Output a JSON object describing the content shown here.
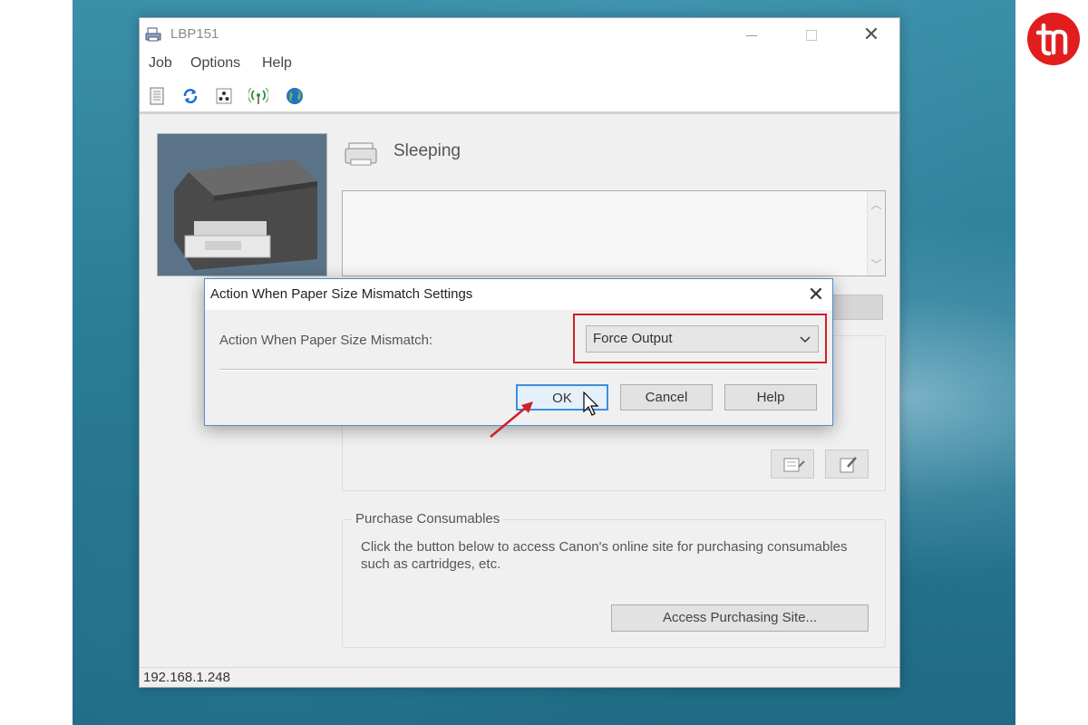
{
  "window": {
    "title": "LBP151",
    "menu": {
      "job": "Job",
      "options": "Options",
      "help": "Help"
    },
    "toolbar_icons": [
      "document-icon",
      "refresh-icon",
      "toner-icon",
      "wireless-icon",
      "globe-icon"
    ],
    "status": "Sleeping",
    "purchase": {
      "legend": "Purchase Consumables",
      "description": "Click the button below to access Canon's online site for purchasing consumables such as cartridges, etc.",
      "button": "Access Purchasing Site..."
    },
    "ip_address": "192.168.1.248"
  },
  "dialog": {
    "title": "Action When Paper Size Mismatch Settings",
    "label": "Action When Paper Size Mismatch:",
    "selected_value": "Force Output",
    "buttons": {
      "ok": "OK",
      "cancel": "Cancel",
      "help": "Help"
    }
  },
  "colors": {
    "highlight": "#d0202a",
    "focus": "#3c8ee0",
    "logo": "#e11d1d"
  }
}
